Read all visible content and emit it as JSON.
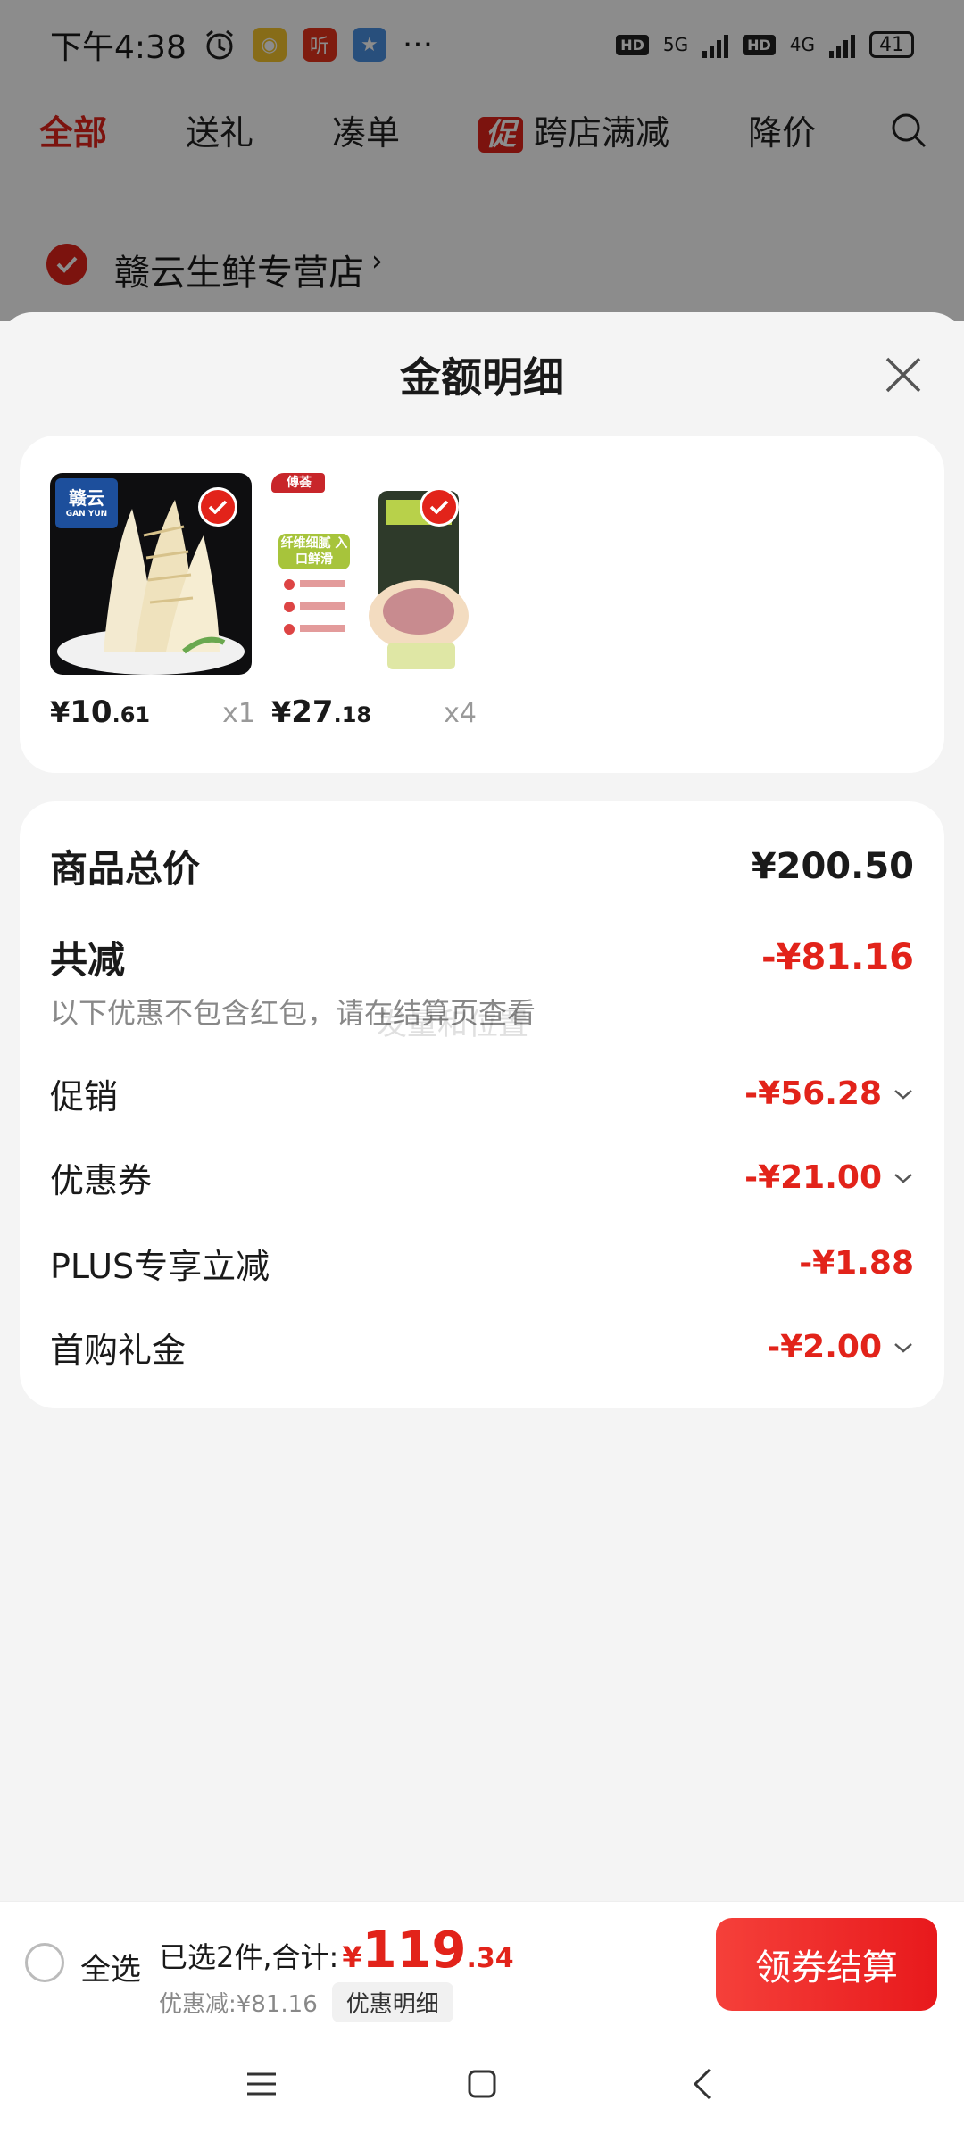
{
  "status_bar": {
    "time": "下午4:38",
    "network_1": "5G",
    "network_2": "4G",
    "hd": "HD",
    "battery": "41",
    "more": "···"
  },
  "tabs": [
    {
      "label": "全部",
      "active": true
    },
    {
      "label": "送礼"
    },
    {
      "label": "凑单"
    },
    {
      "label": "跨店满减",
      "badge": "促"
    },
    {
      "label": "降价"
    }
  ],
  "store": {
    "name": "赣云生鲜专营店",
    "arrow": "›"
  },
  "sheet": {
    "title": "金额明细"
  },
  "products": [
    {
      "brand": "赣云",
      "brand_en": "GAN YUN",
      "price_yuan": "¥",
      "price_int": "10",
      "price_dec": ".61",
      "qty": "x1"
    },
    {
      "brand": "傅荟",
      "tagline": "纤维细腻 入口鲜滑",
      "price_yuan": "¥",
      "price_int": "27",
      "price_dec": ".18",
      "qty": "x4"
    }
  ],
  "detail": {
    "total_label": "商品总价",
    "total_value": "¥200.50",
    "reduce_label": "共减",
    "reduce_value": "-¥81.16",
    "note": "以下优惠不包含红包，请在结算页查看",
    "watermark": "发量和位置",
    "items": [
      {
        "label": "促销",
        "value": "-¥56.28"
      },
      {
        "label": "优惠券",
        "value": "-¥21.00"
      },
      {
        "label": "PLUS专享立减",
        "value": "-¥1.88"
      },
      {
        "label": "首购礼金",
        "value": "-¥2.00"
      }
    ]
  },
  "bottom": {
    "select_all": "全选",
    "selected_text": "已选2件,合计:",
    "total_yuan": "¥",
    "total_int": "119",
    "total_dec": ".34",
    "discount_text": "优惠减:¥81.16",
    "detail_btn": "优惠明细",
    "checkout": "领券结算"
  },
  "colors": {
    "accent": "#e2231a",
    "background": "#f4f4f4"
  }
}
